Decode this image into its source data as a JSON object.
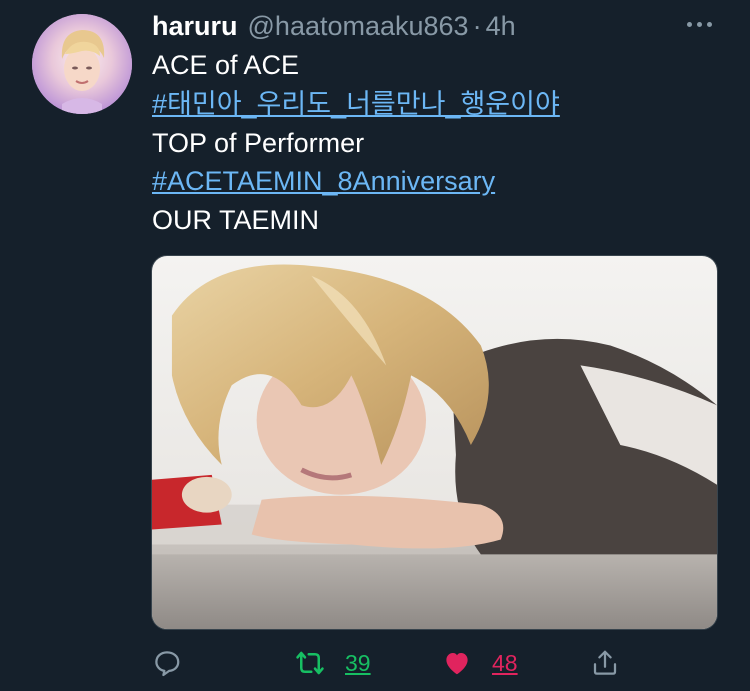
{
  "tweet": {
    "display_name": "haruru",
    "handle": "@haatomaaku863",
    "separator": "·",
    "time": "4h",
    "lines": [
      {
        "text": "ACE of ACE",
        "type": "text"
      },
      {
        "text": "#태민아_우리도_너를만나_행운이야",
        "type": "hashtag"
      },
      {
        "text": "TOP of Performer",
        "type": "text"
      },
      {
        "text": "#ACETAEMIN_8Anniversary",
        "type": "hashtag"
      },
      {
        "text": "OUR TAEMIN",
        "type": "text"
      }
    ]
  },
  "actions": {
    "reply_icon": "reply-icon",
    "retweet_icon": "retweet-icon",
    "retweet_count": "39",
    "like_icon": "heart-icon",
    "like_count": "48",
    "share_icon": "share-icon"
  },
  "colors": {
    "background": "#15202b",
    "link": "#6cb7f5",
    "muted": "#8899a6",
    "retweet": "#17bf63",
    "like": "#e0245e"
  }
}
